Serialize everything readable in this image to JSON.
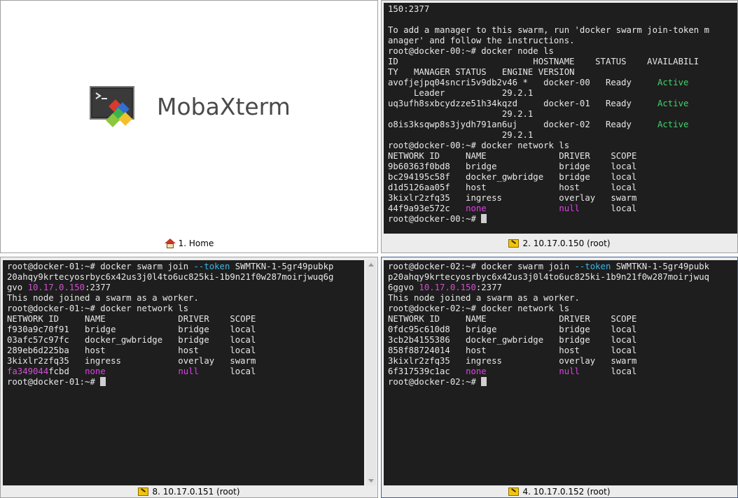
{
  "home": {
    "logo_text": "MobaXterm",
    "caption": "1. Home"
  },
  "sessions": {
    "s2": {
      "caption": "2. 10.17.0.150 (root)"
    },
    "s8": {
      "caption": "8. 10.17.0.151 (root)"
    },
    "s4": {
      "caption": "4. 10.17.0.152 (root)"
    }
  },
  "terminals": {
    "s2": [
      [
        {
          "t": "150:2377"
        }
      ],
      [
        {
          "t": ""
        }
      ],
      [
        {
          "t": "To add a manager to this swarm, run 'docker swarm join-token m"
        }
      ],
      [
        {
          "t": "anager' and follow the instructions."
        }
      ],
      [
        {
          "t": "root@docker-00:~# docker node ls"
        }
      ],
      [
        {
          "t": "ID                          HOSTNAME    STATUS    AVAILABILI"
        }
      ],
      [
        {
          "t": "TY   MANAGER STATUS   ENGINE VERSION"
        }
      ],
      [
        {
          "t": "avofjejpq04sncri5v9db2v46 *   docker-00   Ready     "
        },
        {
          "t": "Active",
          "c": "active"
        }
      ],
      [
        {
          "t": "     Leader           29.2.1"
        }
      ],
      [
        {
          "t": "uq3ufh8sxbcydzze51h34kqzd     docker-01   Ready     "
        },
        {
          "t": "Active",
          "c": "active"
        }
      ],
      [
        {
          "t": "                      29.2.1"
        }
      ],
      [
        {
          "t": "o8is3ksqwp8s3jydh791an6uj     docker-02   Ready     "
        },
        {
          "t": "Active",
          "c": "active"
        }
      ],
      [
        {
          "t": "                      29.2.1"
        }
      ],
      [
        {
          "t": "root@docker-00:~# docker network ls"
        }
      ],
      [
        {
          "t": "NETWORK ID     NAME              DRIVER    SCOPE"
        }
      ],
      [
        {
          "t": "9b60363f0bd8   bridge            bridge    local"
        }
      ],
      [
        {
          "t": "bc294195c58f   docker_gwbridge   bridge    local"
        }
      ],
      [
        {
          "t": "d1d5126aa05f   host              host      local"
        }
      ],
      [
        {
          "t": "3kixlr2zfq35   ingress           overlay   swarm"
        }
      ],
      [
        {
          "t": "44f9a93e572c   "
        },
        {
          "t": "none",
          "c": "none"
        },
        {
          "t": "              "
        },
        {
          "t": "null",
          "c": "none"
        },
        {
          "t": "      local"
        }
      ],
      [
        {
          "t": "root@docker-00:~# "
        },
        {
          "cursor": true
        }
      ]
    ],
    "s8": [
      [
        {
          "t": "root@docker-01:~# docker swarm join "
        },
        {
          "t": "--token",
          "c": "token"
        },
        {
          "t": " SWMTKN-1-5gr49pubkp"
        }
      ],
      [
        {
          "t": "20ahqy9krtecyosrbyc6x42us3j0l4to6uc825ki-1b9n21f0w287moirjwuq6g"
        }
      ],
      [
        {
          "t": "gvo "
        },
        {
          "t": "10.17.0.150",
          "c": "ip"
        },
        {
          "t": ":2377"
        }
      ],
      [
        {
          "t": "This node joined a swarm as a worker."
        }
      ],
      [
        {
          "t": "root@docker-01:~# docker network ls"
        }
      ],
      [
        {
          "t": "NETWORK ID     NAME              DRIVER    SCOPE"
        }
      ],
      [
        {
          "t": "f930a9c70f91   bridge            bridge    local"
        }
      ],
      [
        {
          "t": "03afc57c97fc   docker_gwbridge   bridge    local"
        }
      ],
      [
        {
          "t": "289eb6d225ba   host              host      local"
        }
      ],
      [
        {
          "t": "3kixlr2zfq35   ingress           overlay   swarm"
        }
      ],
      [
        {
          "t": "fa349044",
          "c": "idpart"
        },
        {
          "t": "fcbd   "
        },
        {
          "t": "none",
          "c": "none"
        },
        {
          "t": "              "
        },
        {
          "t": "null",
          "c": "none"
        },
        {
          "t": "      local"
        }
      ],
      [
        {
          "t": "root@docker-01:~# "
        },
        {
          "cursor": true
        }
      ]
    ],
    "s4": [
      [
        {
          "t": "root@docker-02:~# docker swarm join "
        },
        {
          "t": "--token",
          "c": "token"
        },
        {
          "t": " SWMTKN-1-5gr49pubk"
        }
      ],
      [
        {
          "t": "p20ahqy9krtecyosrbyc6x42us3j0l4to6uc825ki-1b9n21f0w287moirjwuq"
        }
      ],
      [
        {
          "t": "6ggvo "
        },
        {
          "t": "10.17.0.150",
          "c": "ip"
        },
        {
          "t": ":2377"
        }
      ],
      [
        {
          "t": "This node joined a swarm as a worker."
        }
      ],
      [
        {
          "t": "root@docker-02:~# docker network ls"
        }
      ],
      [
        {
          "t": "NETWORK ID     NAME              DRIVER    SCOPE"
        }
      ],
      [
        {
          "t": "0fdc95c610d8   bridge            bridge    local"
        }
      ],
      [
        {
          "t": "3cb2b4155386   docker_gwbridge   bridge    local"
        }
      ],
      [
        {
          "t": "858f88724014   host              host      local"
        }
      ],
      [
        {
          "t": "3kixlr2zfq35   ingress           overlay   swarm"
        }
      ],
      [
        {
          "t": "6f317539c1ac   "
        },
        {
          "t": "none",
          "c": "none"
        },
        {
          "t": "              "
        },
        {
          "t": "null",
          "c": "none"
        },
        {
          "t": "      local"
        }
      ],
      [
        {
          "t": "root@docker-02:~# "
        },
        {
          "cursor": true
        }
      ]
    ]
  },
  "colors": {
    "terminal_bg": "#1e1e1e",
    "terminal_fg": "#e8e8e8",
    "token": "#3db7e8",
    "ip": "#d34fd3",
    "none": "#e040e8",
    "active": "#3fd36b",
    "active_pane_border": "#3a5fa0"
  },
  "icons": {
    "home_tab": "home-icon",
    "ssh_tab": "wrench-icon",
    "logo": "mobaxterm-logo-icon"
  }
}
